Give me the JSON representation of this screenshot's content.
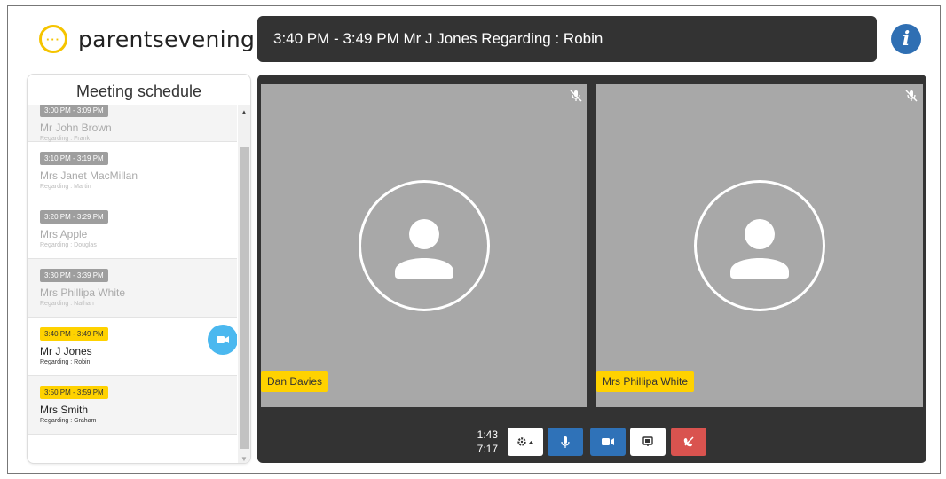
{
  "logo": {
    "text": "parentsevening",
    "mark": "···"
  },
  "header": {
    "title": "3:40 PM - 3:49 PM Mr J Jones Regarding : Robin"
  },
  "info_button": {
    "label": "i"
  },
  "schedule": {
    "title": "Meeting schedule",
    "items": [
      {
        "time": "3:00 PM - 3:09 PM",
        "name": "Mr John Brown",
        "regarding": "Regarding : Frank",
        "state": "past"
      },
      {
        "time": "3:10 PM - 3:19 PM",
        "name": "Mrs Janet MacMillan",
        "regarding": "Regarding : Martin",
        "state": "past"
      },
      {
        "time": "3:20 PM - 3:29 PM",
        "name": "Mrs Apple",
        "regarding": "Regarding : Douglas",
        "state": "past"
      },
      {
        "time": "3:30 PM - 3:39 PM",
        "name": "Mrs Phillipa White",
        "regarding": "Regarding : Nathan",
        "state": "past"
      },
      {
        "time": "3:40 PM - 3:49 PM",
        "name": "Mr J Jones",
        "regarding": "Regarding : Robin",
        "state": "current"
      },
      {
        "time": "3:50 PM - 3:59 PM",
        "name": "Mrs Smith",
        "regarding": "Regarding : Graham",
        "state": "upcoming"
      }
    ]
  },
  "video": {
    "participants": [
      {
        "name": "Dan Davies",
        "muted": true
      },
      {
        "name": "Mrs Phillipa White",
        "muted": true
      }
    ],
    "timer": {
      "elapsed": "1:43",
      "remaining": "7:17"
    }
  },
  "colors": {
    "accent": "#ffd200",
    "dark": "#333333",
    "blue": "#2f72b8",
    "danger": "#d9534f",
    "tile": "#a8a8a8"
  }
}
